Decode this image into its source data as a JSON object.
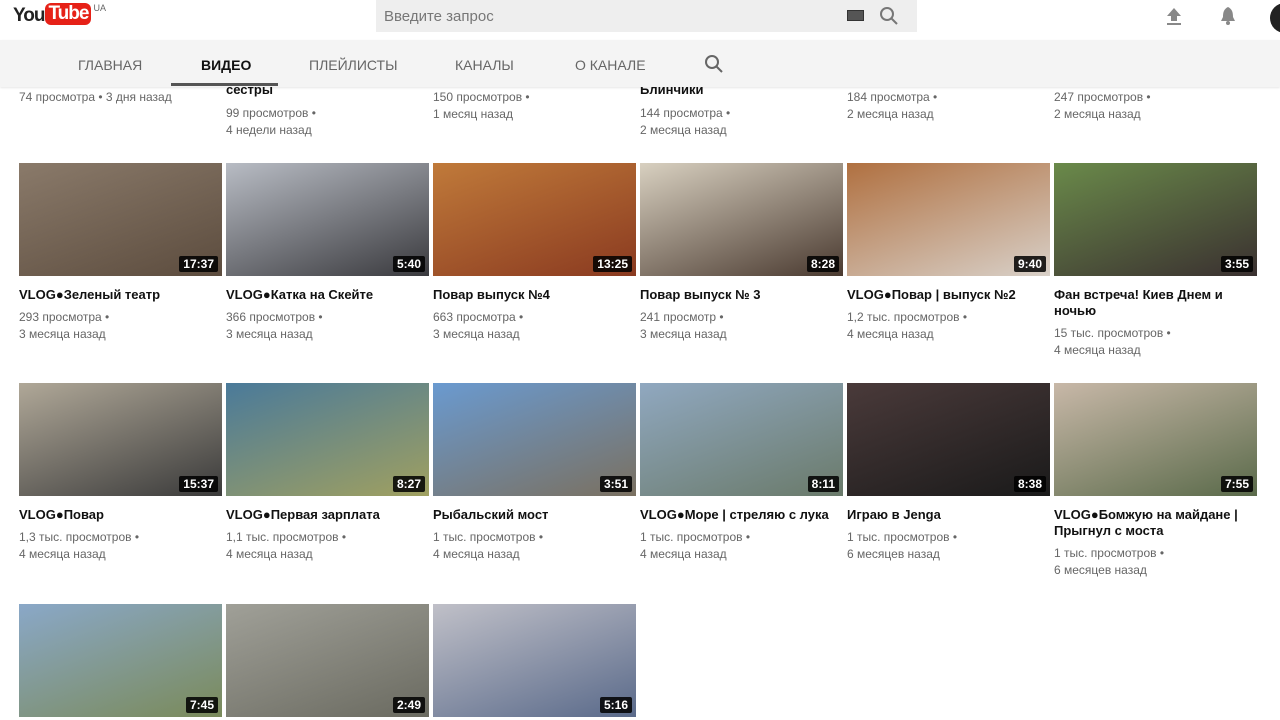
{
  "header": {
    "logo_you": "You",
    "logo_tube": "Tube",
    "region": "UA",
    "search_placeholder": "Введите запрос"
  },
  "tabs": [
    {
      "label": "ГЛАВНАЯ"
    },
    {
      "label": "ВИДЕО"
    },
    {
      "label": "ПЛЕЙЛИСТЫ"
    },
    {
      "label": "КАНАЛЫ"
    },
    {
      "label": "О КАНАЛЕ"
    }
  ],
  "partial_row": [
    {
      "title": "",
      "views": "74 просмотра • 3 дня назад",
      "age": ""
    },
    {
      "title": "сестры",
      "views": "99 просмотров •",
      "age": "4 недели назад"
    },
    {
      "title": "",
      "views": "150 просмотров •",
      "age": "1 месяц назад"
    },
    {
      "title": "Блинчики",
      "views": "144 просмотра •",
      "age": "2 месяца назад"
    },
    {
      "title": "",
      "views": "184 просмотра •",
      "age": "2 месяца назад"
    },
    {
      "title": "",
      "views": "247 просмотров •",
      "age": "2 месяца назад"
    }
  ],
  "rows": [
    [
      {
        "title": "VLOG●Зеленый театр",
        "views": "293 просмотра •",
        "age": "3 месяца назад",
        "duration": "17:37",
        "c1": "#8a7a6a",
        "c2": "#5c4c3e"
      },
      {
        "title": "VLOG●Катка на Скейте",
        "views": "366 просмотров •",
        "age": "3 месяца назад",
        "duration": "5:40",
        "c1": "#b8bcc4",
        "c2": "#3a3a3e"
      },
      {
        "title": "Повар выпуск №4",
        "views": "663 просмотра •",
        "age": "3 месяца назад",
        "duration": "13:25",
        "c1": "#c07a3a",
        "c2": "#8a3a20"
      },
      {
        "title": "Повар выпуск № 3",
        "views": "241 просмотр •",
        "age": "3 месяца назад",
        "duration": "8:28",
        "c1": "#d8d0c0",
        "c2": "#4a3a30"
      },
      {
        "title": "VLOG●Повар | выпуск №2",
        "views": "1,2 тыс. просмотров •",
        "age": "4 месяца назад",
        "duration": "9:40",
        "c1": "#b07040",
        "c2": "#d8d0c8"
      },
      {
        "title": "Фан встреча! Киев Днем и ночью",
        "views": "15 тыс. просмотров •",
        "age": "4 месяца назад",
        "duration": "3:55",
        "c1": "#6a8a4a",
        "c2": "#3a3030"
      }
    ],
    [
      {
        "title": "VLOG●Повар",
        "views": "1,3 тыс. просмотров •",
        "age": "4 месяца назад",
        "duration": "15:37",
        "c1": "#b0a898",
        "c2": "#3a3a3a"
      },
      {
        "title": "VLOG●Первая зарплата",
        "views": "1,1 тыс. просмотров •",
        "age": "4 месяца назад",
        "duration": "8:27",
        "c1": "#4a7a9a",
        "c2": "#a0a060"
      },
      {
        "title": "Рыбальский мост",
        "views": "1 тыс. просмотров •",
        "age": "4 месяца назад",
        "duration": "3:51",
        "c1": "#6a9ad0",
        "c2": "#7a7060"
      },
      {
        "title": "VLOG●Море | стреляю с лука",
        "views": "1 тыс. просмотров •",
        "age": "4 месяца назад",
        "duration": "8:11",
        "c1": "#90a8c0",
        "c2": "#6a7a6a"
      },
      {
        "title": "Играю в Jenga",
        "views": "1 тыс. просмотров •",
        "age": "6 месяцев назад",
        "duration": "8:38",
        "c1": "#4a3a3a",
        "c2": "#1a1a1a"
      },
      {
        "title": "VLOG●Бомжую на майдане | Прыгнул с моста",
        "views": "1 тыс. просмотров •",
        "age": "6 месяцев назад",
        "duration": "7:55",
        "c1": "#c8b8a8",
        "c2": "#5a6a4a"
      }
    ],
    [
      {
        "title": "",
        "views": "",
        "age": "",
        "duration": "7:45",
        "c1": "#8aa8c8",
        "c2": "#7a8a5a"
      },
      {
        "title": "",
        "views": "",
        "age": "",
        "duration": "2:49",
        "c1": "#a0a098",
        "c2": "#6a6a60"
      },
      {
        "title": "",
        "views": "",
        "age": "",
        "duration": "5:16",
        "c1": "#c0c0c8",
        "c2": "#5a6a8a"
      }
    ]
  ]
}
